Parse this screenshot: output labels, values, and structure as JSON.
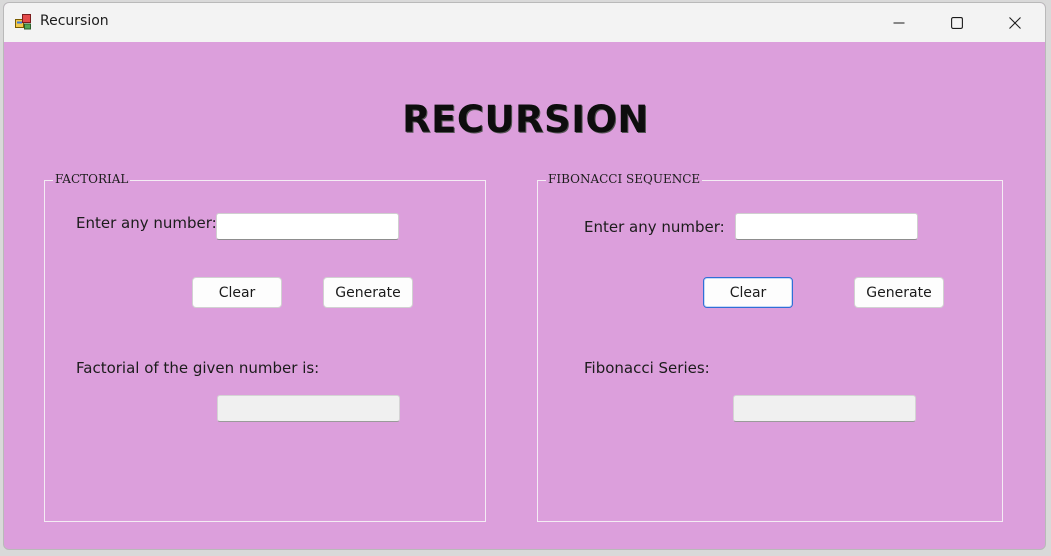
{
  "window": {
    "title": "Recursion",
    "app_icon": "winforms-app-icon",
    "controls": [
      "minimize-icon",
      "maximize-icon",
      "close-icon"
    ]
  },
  "heading": "RECURSION",
  "factorial": {
    "legend": "FACTORIAL",
    "input_label": "Enter any number:",
    "input_value": "",
    "clear_label": "Clear",
    "generate_label": "Generate",
    "result_label": "Factorial of the given number is:",
    "result_value": ""
  },
  "fibonacci": {
    "legend": "FIBONACCI SEQUENCE",
    "input_label": "Enter any number:",
    "input_value": "",
    "clear_label": "Clear",
    "generate_label": "Generate",
    "result_label": "Fibonacci Series:",
    "result_value": ""
  },
  "colors": {
    "form_background": "#dc9fdc",
    "focus_border": "#2f6fd6"
  }
}
